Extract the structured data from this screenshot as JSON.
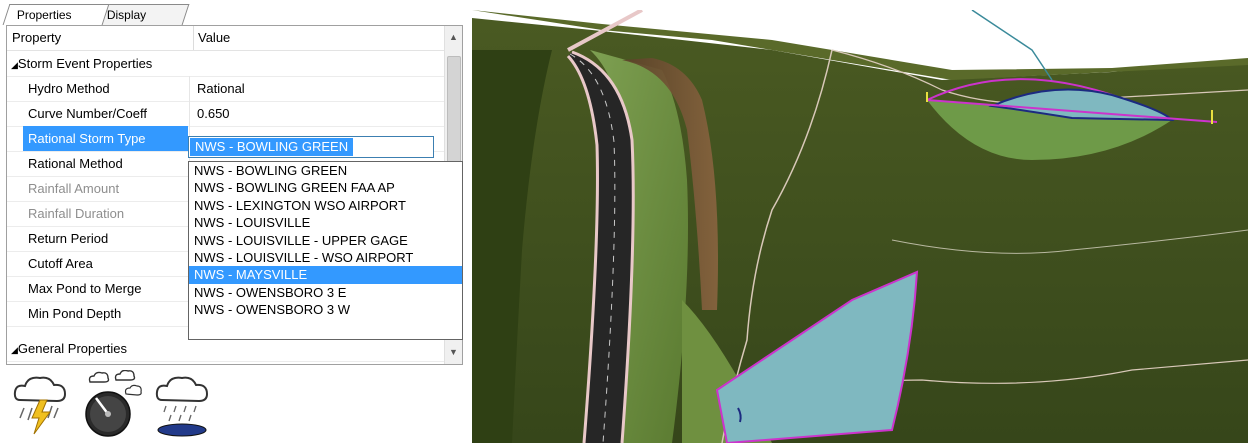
{
  "tabs": [
    {
      "label": "Properties",
      "active": true
    },
    {
      "label": "Display",
      "active": false
    }
  ],
  "grid": {
    "header": {
      "property": "Property",
      "value": "Value"
    },
    "category_storm": "Storm Event Properties",
    "rows": [
      {
        "property": "Hydro Method",
        "value": "Rational",
        "enabled": true
      },
      {
        "property": "Curve Number/Coeff",
        "value": "0.650",
        "enabled": true
      },
      {
        "property": "Rational Storm Type",
        "value": "NWS - BOWLING GREEN",
        "enabled": true,
        "selected": true
      },
      {
        "property": "Rational Method",
        "value": "",
        "enabled": true
      },
      {
        "property": "Rainfall Amount",
        "value": "",
        "enabled": false
      },
      {
        "property": "Rainfall Duration",
        "value": "",
        "enabled": false
      },
      {
        "property": "Return Period",
        "value": "",
        "enabled": true
      },
      {
        "property": "Cutoff Area",
        "value": "",
        "enabled": true
      },
      {
        "property": "Max Pond to Merge",
        "value": "",
        "enabled": true
      },
      {
        "property": "Min Pond Depth",
        "value": "",
        "enabled": true
      }
    ],
    "category_general": "General Properties"
  },
  "combo": {
    "selected": "NWS - BOWLING GREEN"
  },
  "dropdown": {
    "options": [
      "NWS - BOWLING GREEN",
      "NWS - BOWLING GREEN FAA AP",
      "NWS - LEXINGTON WSO AIRPORT",
      "NWS - LOUISVILLE",
      "NWS - LOUISVILLE - UPPER GAGE",
      "NWS - LOUISVILLE - WSO AIRPORT",
      "NWS - MAYSVILLE",
      "NWS - OWENSBORO 3 E",
      "NWS - OWENSBORO 3 W"
    ],
    "highlighted": "NWS - MAYSVILLE"
  },
  "toolbar_icons": [
    "storm-lightning-icon",
    "rain-dial-icon",
    "rain-pond-icon"
  ],
  "colors": {
    "selection": "#3399ff",
    "terrain": "#3a4a18",
    "pond_water": "#7fb8c0",
    "pond_outline": "#cc33cc",
    "road": "#2a2a2a"
  }
}
